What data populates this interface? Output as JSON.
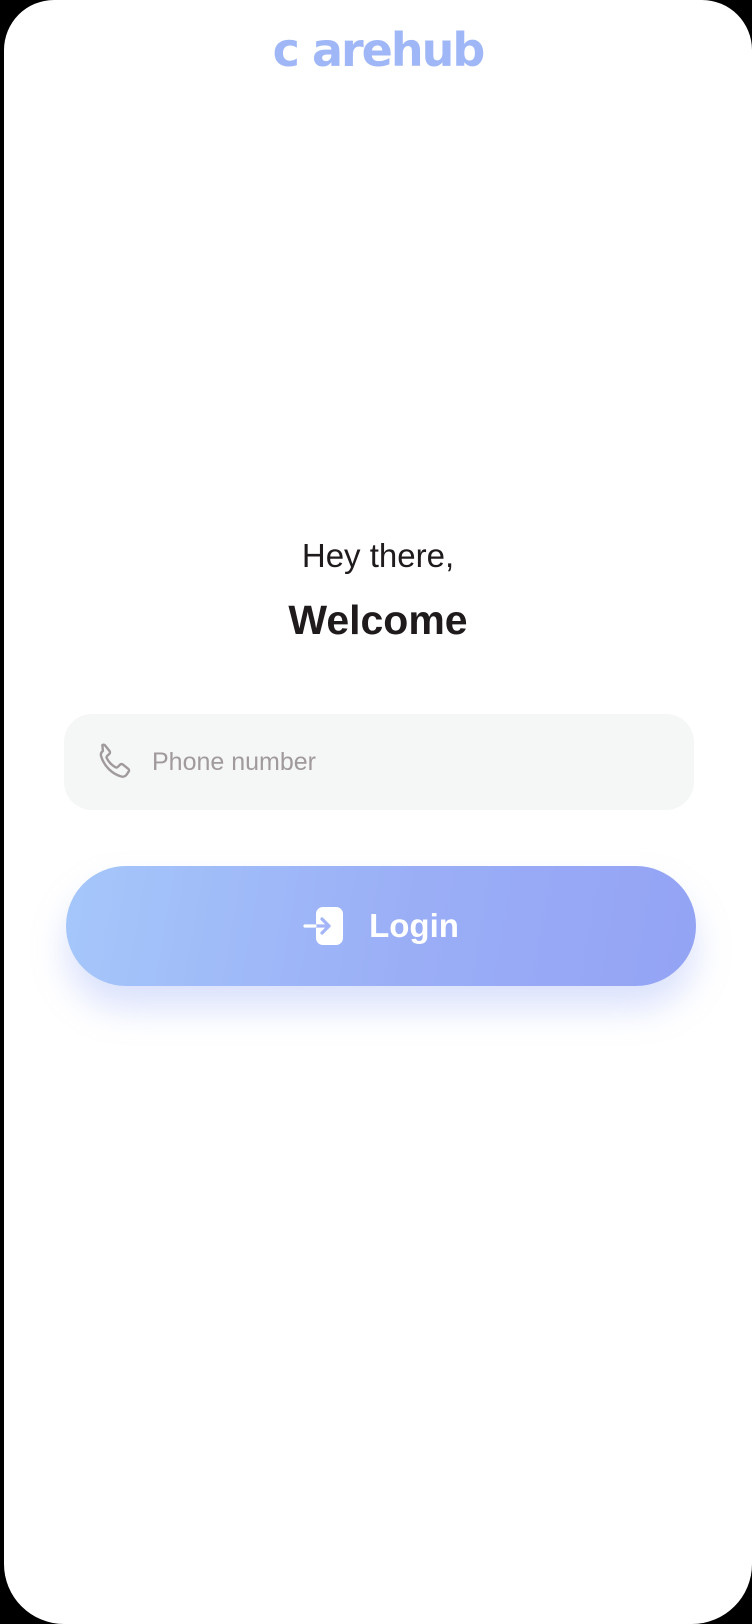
{
  "app": {
    "logo_text": "c arehub",
    "brand_color": "#9fb7f6"
  },
  "welcome": {
    "greeting": "Hey there,",
    "title": "Welcome"
  },
  "login_form": {
    "phone_placeholder": "Phone number",
    "phone_value": "",
    "phone_icon": "phone-icon",
    "login_label": "Login",
    "login_icon": "login-icon",
    "button_gradient_start": "#a5c7fa",
    "button_gradient_end": "#94a3f5",
    "field_background": "#f5f6f6"
  }
}
